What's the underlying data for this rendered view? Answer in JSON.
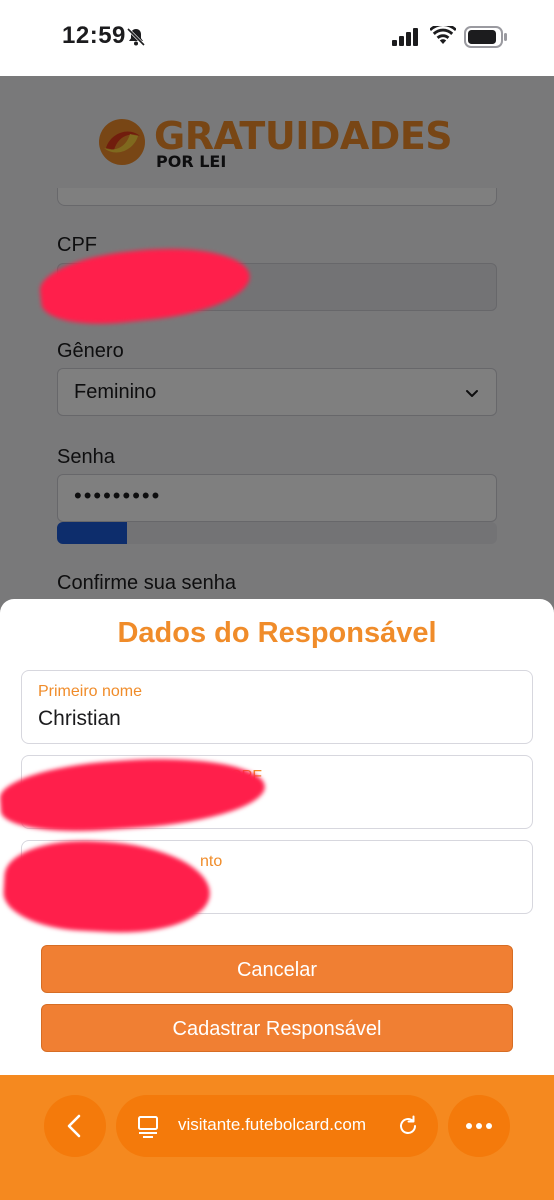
{
  "status_bar": {
    "time": "12:59"
  },
  "brand": {
    "name": "GRATUIDADES",
    "sub": "POR LEI"
  },
  "form": {
    "cpf_label": "CPF",
    "gender_label": "Gênero",
    "gender_value": "Feminino",
    "password_label": "Senha",
    "password_value": "•••••••••",
    "password_strength": 0.16,
    "confirm_label": "Confirme sua senha"
  },
  "sheet": {
    "title": "Dados do Responsável",
    "first_name_label": "Primeiro nome",
    "first_name_value": "Christian",
    "cpf_label_partial": "CPF",
    "birth_label_partial": "nto",
    "cancel_label": "Cancelar",
    "submit_label": "Cadastrar Responsável"
  },
  "browser": {
    "url": "visitante.futebolcard.com"
  },
  "colors": {
    "accent": "#f08c2a",
    "toolbar": "#f5891f",
    "strength": "#1a5bd8"
  }
}
